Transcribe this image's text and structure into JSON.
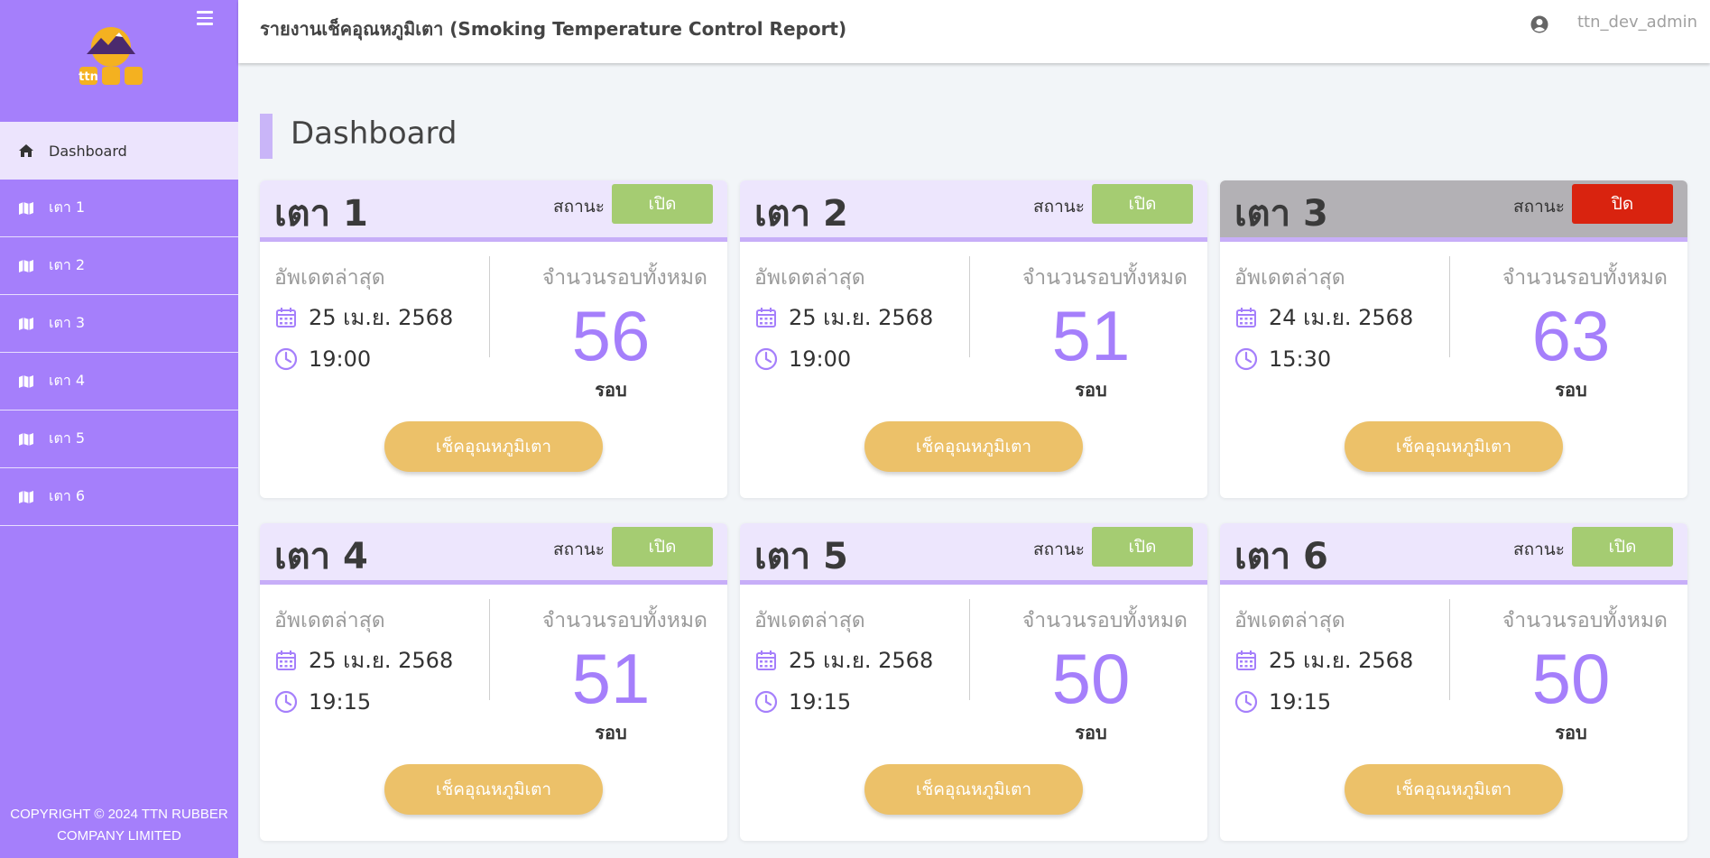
{
  "app": {
    "title": "รายงานเช็คอุณหภูมิเตา (Smoking Temperature Control Report)",
    "username": "ttn_dev_admin",
    "page_heading": "Dashboard",
    "logo_text": "ttn"
  },
  "sidebar": {
    "items": [
      {
        "label": "Dashboard",
        "icon": "home-icon",
        "active": true
      },
      {
        "label": "เตา 1",
        "icon": "map-icon"
      },
      {
        "label": "เตา 2",
        "icon": "map-icon"
      },
      {
        "label": "เตา 3",
        "icon": "map-icon"
      },
      {
        "label": "เตา 4",
        "icon": "map-icon"
      },
      {
        "label": "เตา 5",
        "icon": "map-icon"
      },
      {
        "label": "เตา 6",
        "icon": "map-icon"
      }
    ],
    "copyright_line1": "COPYRIGHT © 2024 TTN RUBBER",
    "copyright_line2": "COMPANY LIMITED"
  },
  "labels": {
    "status": "สถานะ",
    "last_update": "อัพเดตล่าสุด",
    "total_rounds": "จำนวนรอบทั้งหมด",
    "unit": "รอบ",
    "check_button": "เช็คอุณหภูมิเตา"
  },
  "colors": {
    "accent": "#a57ffb",
    "status_open": "#a5cc72",
    "status_closed": "#d9230f",
    "button": "#ecc169"
  },
  "ovens": [
    {
      "name": "เตา 1",
      "status": "เปิด",
      "is_open": true,
      "date": "25 เม.ย. 2568",
      "time": "19:00",
      "rounds": "56"
    },
    {
      "name": "เตา 2",
      "status": "เปิด",
      "is_open": true,
      "date": "25 เม.ย. 2568",
      "time": "19:00",
      "rounds": "51"
    },
    {
      "name": "เตา 3",
      "status": "ปิด",
      "is_open": false,
      "date": "24 เม.ย. 2568",
      "time": "15:30",
      "rounds": "63"
    },
    {
      "name": "เตา 4",
      "status": "เปิด",
      "is_open": true,
      "date": "25 เม.ย. 2568",
      "time": "19:15",
      "rounds": "51"
    },
    {
      "name": "เตา 5",
      "status": "เปิด",
      "is_open": true,
      "date": "25 เม.ย. 2568",
      "time": "19:15",
      "rounds": "50"
    },
    {
      "name": "เตา 6",
      "status": "เปิด",
      "is_open": true,
      "date": "25 เม.ย. 2568",
      "time": "19:15",
      "rounds": "50"
    }
  ]
}
